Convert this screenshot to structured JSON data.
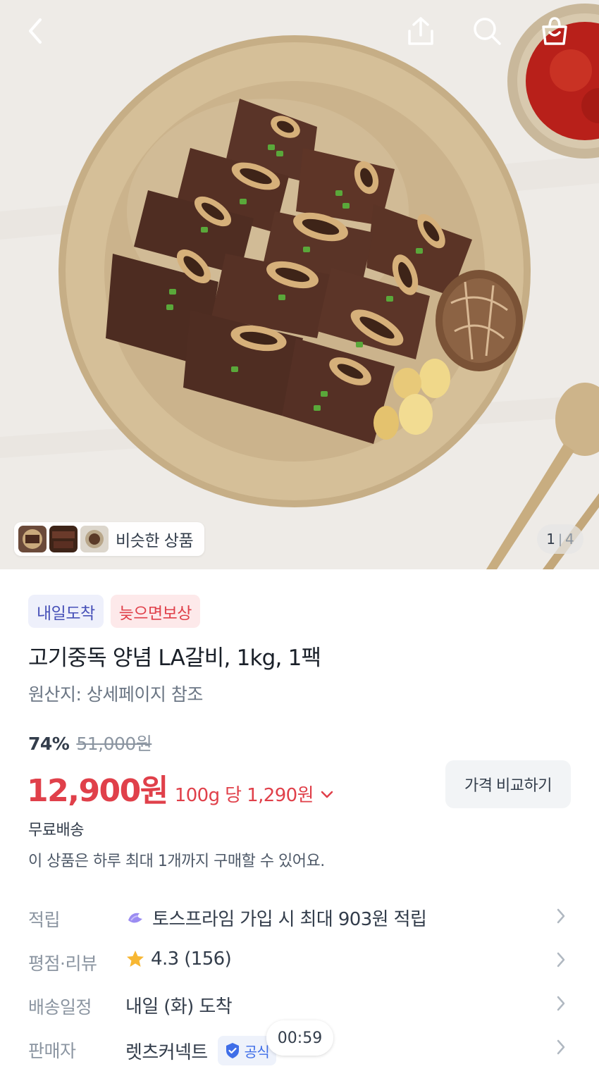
{
  "gallery": {
    "similar_label": "비슷한 상품",
    "page_current": "1",
    "page_separator": "|",
    "page_total": "4"
  },
  "top_bar": {
    "icons": [
      "back-icon",
      "share-icon",
      "search-icon",
      "cart-icon"
    ]
  },
  "badges": {
    "arrival": "내일도착",
    "late_comp": "늦으면보상"
  },
  "product": {
    "title": "고기중독 양념 LA갈비, 1kg, 1팩",
    "origin": "원산지: 상세페이지 참조"
  },
  "price": {
    "discount_rate": "74%",
    "original": "51,000원",
    "sale": "12,900원",
    "unit": "100g 당 1,290원",
    "compare_button": "가격 비교하기"
  },
  "shipping": {
    "free": "무료배송",
    "limit_note": "이 상품은 하루 최대 1개까지 구매할 수 있어요."
  },
  "info_rows": {
    "points": {
      "label": "적립",
      "value": "토스프라임 가입 시 최대 903원 적립"
    },
    "rating": {
      "label": "평점·리뷰",
      "value": "4.3 (156)"
    },
    "delivery": {
      "label": "배송일정",
      "value": "내일 (화) 도착"
    },
    "seller": {
      "label": "판매자",
      "value": "렛츠커넥트",
      "badge": "공식"
    }
  },
  "timer": "00:59",
  "colors": {
    "accent_red": "#e0404a",
    "badge_blue_text": "#4751b8",
    "badge_blue_bg": "#eef0fb",
    "badge_red_bg": "#fde9ea",
    "star": "#f7b733"
  }
}
